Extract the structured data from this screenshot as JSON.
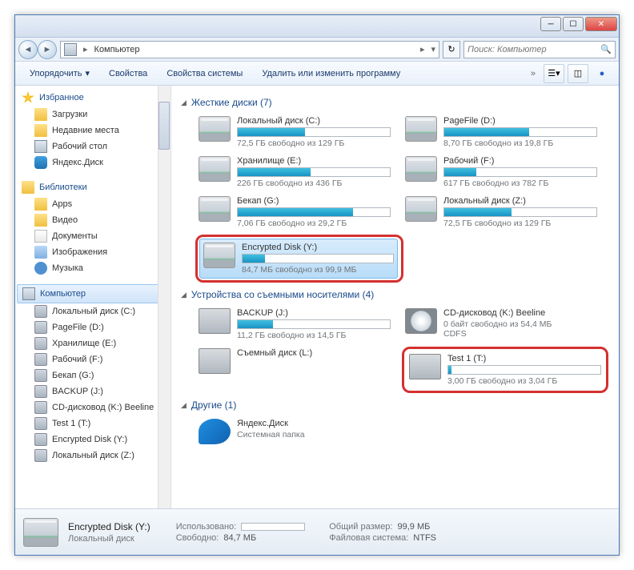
{
  "window": {
    "address": "Компьютер",
    "search_placeholder": "Поиск: Компьютер"
  },
  "toolbar": {
    "organize": "Упорядочить",
    "properties": "Свойства",
    "system_properties": "Свойства системы",
    "uninstall": "Удалить или изменить программу"
  },
  "sidebar": {
    "favorites": {
      "label": "Избранное",
      "items": [
        "Загрузки",
        "Недавние места",
        "Рабочий стол",
        "Яндекс.Диск"
      ]
    },
    "libraries": {
      "label": "Библиотеки",
      "items": [
        "Apps",
        "Видео",
        "Документы",
        "Изображения",
        "Музыка"
      ]
    },
    "computer": {
      "label": "Компьютер",
      "items": [
        "Локальный диск (C:)",
        "PageFile (D:)",
        "Хранилище (E:)",
        "Рабочий (F:)",
        "Бекап (G:)",
        "BACKUP (J:)",
        "CD-дисковод (K:) Beeline",
        "Test 1 (T:)",
        "Encrypted Disk (Y:)",
        "Локальный диск (Z:)"
      ]
    }
  },
  "sections": {
    "hdd": {
      "label": "Жесткие диски (7)"
    },
    "removable": {
      "label": "Устройства со съемными носителями (4)"
    },
    "other": {
      "label": "Другие (1)"
    }
  },
  "drives": {
    "hdd": [
      {
        "name": "Локальный диск (C:)",
        "free": "72,5 ГБ свободно из 129 ГБ",
        "pct": 44
      },
      {
        "name": "PageFile (D:)",
        "free": "8,70 ГБ свободно из 19,8 ГБ",
        "pct": 56
      },
      {
        "name": "Хранилище (E:)",
        "free": "226 ГБ свободно из 436 ГБ",
        "pct": 48
      },
      {
        "name": "Рабочий (F:)",
        "free": "617 ГБ свободно из 782 ГБ",
        "pct": 21
      },
      {
        "name": "Бекап (G:)",
        "free": "7,06 ГБ свободно из 29,2 ГБ",
        "pct": 76
      },
      {
        "name": "Локальный диск (Z:)",
        "free": "72,5 ГБ свободно из 129 ГБ",
        "pct": 44
      },
      {
        "name": "Encrypted Disk (Y:)",
        "free": "84,7 МБ свободно из 99,9 МБ",
        "pct": 15,
        "selected": true,
        "highlighted": true
      }
    ],
    "removable": [
      {
        "name": "BACKUP (J:)",
        "free": "11,2 ГБ свободно из 14,5 ГБ",
        "pct": 23
      },
      {
        "name_a": "CD-дисковод (K:) Beeline",
        "free_a": "0 байт свободно из 54,4 МБ",
        "sub": "CDFS",
        "cd": true
      },
      {
        "name": "Съемный диск (L:)"
      },
      {
        "name": "Test 1 (T:)",
        "free": "3,00 ГБ свободно из 3,04 ГБ",
        "pct": 2,
        "highlighted": true
      }
    ],
    "other": [
      {
        "name": "Яндекс.Диск",
        "sub": "Системная папка"
      }
    ]
  },
  "statusbar": {
    "title": "Encrypted Disk (Y:)",
    "subtitle": "Локальный диск",
    "used_label": "Использовано:",
    "free_label": "Свободно:",
    "free_val": "84,7 МБ",
    "total_label": "Общий размер:",
    "total_val": "99,9 МБ",
    "fs_label": "Файловая система:",
    "fs_val": "NTFS",
    "pct": 15
  }
}
